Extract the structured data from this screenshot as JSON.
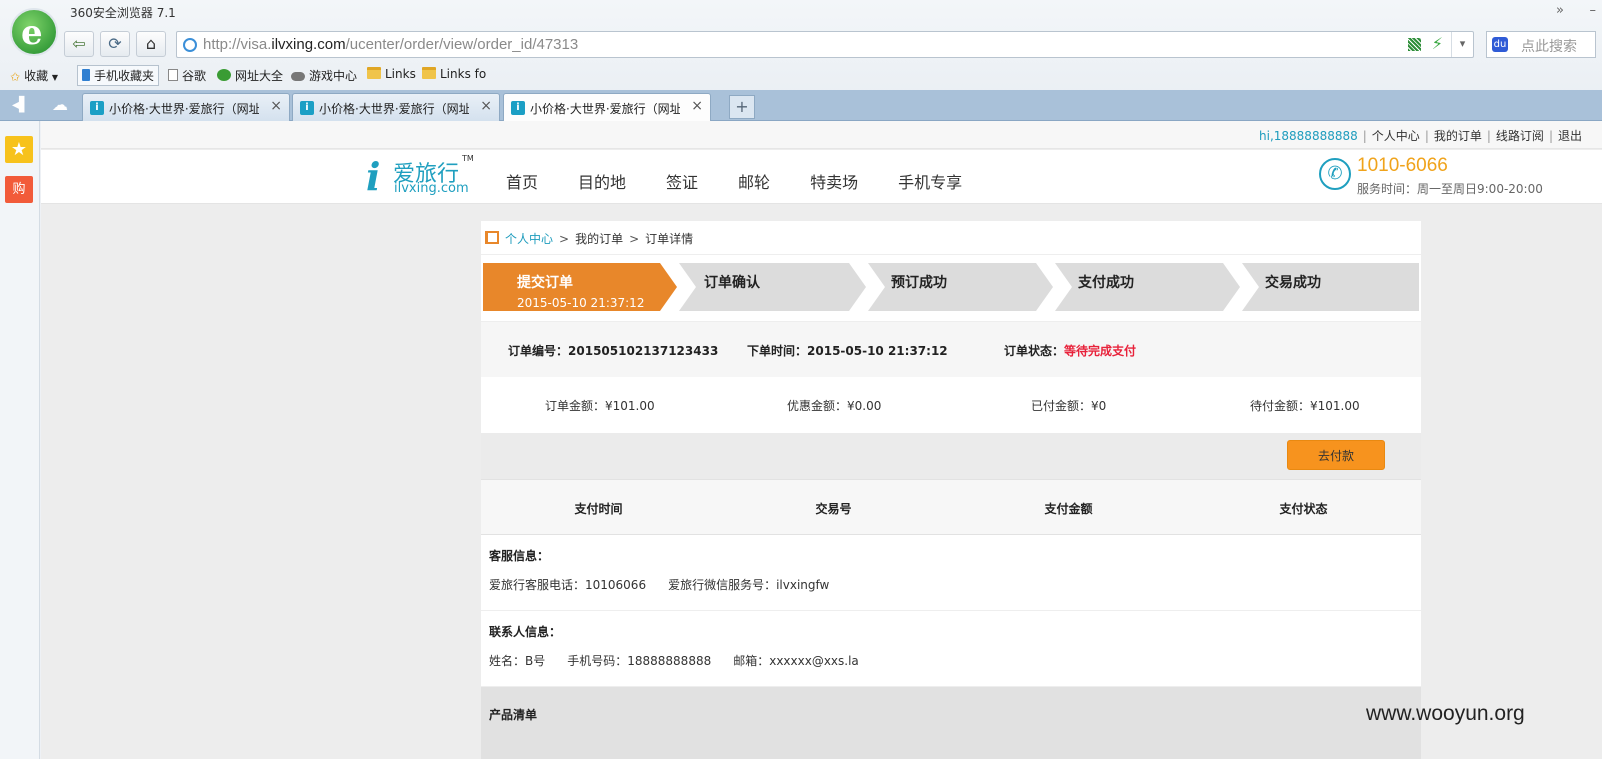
{
  "browser": {
    "app_title": "360安全浏览器 7.1",
    "logo_glyph": "e",
    "window_more": "»",
    "window_min": "–",
    "nav": {
      "back": "⇦",
      "refresh": "⟳",
      "home": "⌂"
    },
    "address": {
      "prefix": "http://visa.",
      "domain": "ilvxing.com",
      "path": "/ucenter/order/view/order_id/47313"
    },
    "address_dropdown": "▾",
    "search_placeholder": "点此搜索",
    "search_engine_glyph": "du",
    "bookmarks": [
      {
        "label": "收藏",
        "icon": "star-icon"
      },
      {
        "label": "手机收藏夹",
        "icon": "mobile-icon"
      },
      {
        "label": "谷歌",
        "icon": "page-icon"
      },
      {
        "label": "网址大全",
        "icon": "globe-icon"
      },
      {
        "label": "游戏中心",
        "icon": "gamepad-icon"
      },
      {
        "label": "Links",
        "icon": "folder-icon"
      },
      {
        "label": "Links fo",
        "icon": "folder-icon"
      }
    ],
    "tabs": [
      {
        "title": "小价格·大世界·爱旅行（网址：",
        "active": false
      },
      {
        "title": "小价格·大世界·爱旅行（网址：",
        "active": false
      },
      {
        "title": "小价格·大世界·爱旅行（网址：",
        "active": true
      }
    ],
    "tab_close": "×",
    "tab_new": "+",
    "side": {
      "fav_glyph": "★",
      "buy_glyph": "购"
    }
  },
  "site": {
    "top_links": {
      "greeting": "hi,",
      "username": "18888888888",
      "items": [
        "个人中心",
        "我的订单",
        "线路订阅",
        "退出"
      ]
    },
    "logo": {
      "mark": "i",
      "cn": "爱旅行",
      "en": "ilvxing.com",
      "tm": "TM"
    },
    "nav": [
      "首页",
      "目的地",
      "签证",
      "邮轮",
      "特卖场",
      "手机专享"
    ],
    "hotline": {
      "number": "1010-6066",
      "hours": "服务时间：周一至周日9:00-20:00",
      "icon_glyph": "✆"
    }
  },
  "breadcrumb": {
    "home": "个人中心",
    "sep": ">",
    "orders": "我的订单",
    "current": "订单详情"
  },
  "steps": [
    {
      "label": "提交订单",
      "sub": "2015-05-10 21:37:12",
      "active": true
    },
    {
      "label": "订单确认",
      "sub": "",
      "active": false
    },
    {
      "label": "预订成功",
      "sub": "",
      "active": false
    },
    {
      "label": "支付成功",
      "sub": "",
      "active": false
    },
    {
      "label": "交易成功",
      "sub": "",
      "active": false
    }
  ],
  "order": {
    "number_label": "订单编号：",
    "number": "201505102137123433",
    "time_label": "下单时间：",
    "time": "2015-05-10 21:37:12",
    "status_label": "订单状态：",
    "status": "等待完成支付"
  },
  "amounts": {
    "total": "订单金额：¥101.00",
    "discount": "优惠金额：¥0.00",
    "paid": "已付金额：¥0",
    "due": "待付金额：¥101.00"
  },
  "pay_button": "去付款",
  "payment_table": {
    "headers": [
      "支付时间",
      "交易号",
      "支付金额",
      "支付状态"
    ]
  },
  "service_info": {
    "title": "客服信息：",
    "phone": "爱旅行客服电话：10106066",
    "wechat": "爱旅行微信服务号：ilvxingfw"
  },
  "contact_info": {
    "title": "联系人信息：",
    "name": "姓名：B号",
    "mobile": "手机号码：18888888888",
    "email": "邮箱：xxxxxx@xxs.la"
  },
  "products": {
    "title": "产品清单"
  },
  "watermark": "www.wooyun.org",
  "colors": {
    "step_active": "#e8872a",
    "step_inactive": "#dcdcdc",
    "accent_teal": "#1f9fbf",
    "pay_button": "#f7931e",
    "status_red": "#e8223b"
  }
}
